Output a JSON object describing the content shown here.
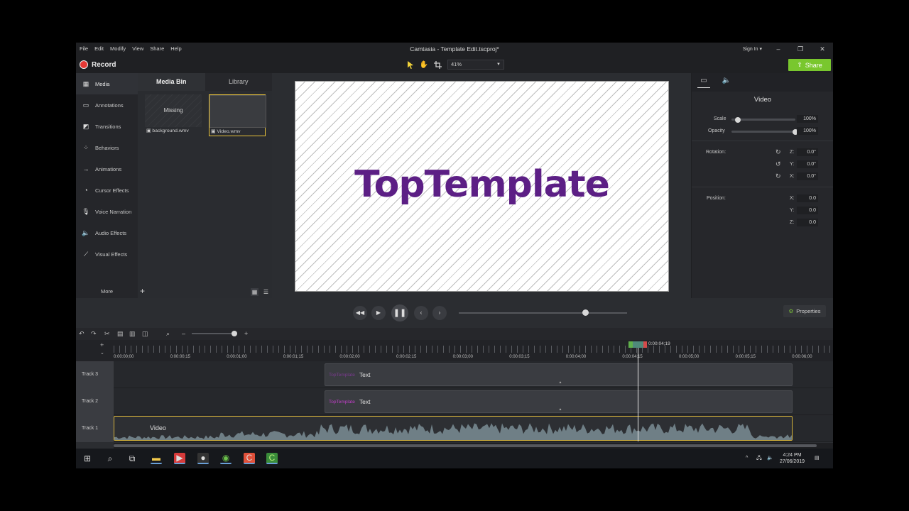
{
  "window": {
    "title": "Camtasia - Template Edit.tscproj*",
    "menu": [
      "File",
      "Edit",
      "Modify",
      "View",
      "Share",
      "Help"
    ],
    "sign_in": "Sign In ▾",
    "minimize": "–",
    "restore": "❐",
    "close": "✕"
  },
  "toolbar": {
    "record_label": "Record",
    "zoom_value": "41%",
    "share_label": "Share"
  },
  "sidebar": {
    "items": [
      {
        "label": "Media",
        "icon": "media-icon"
      },
      {
        "label": "Annotations",
        "icon": "annotations-icon"
      },
      {
        "label": "Transitions",
        "icon": "transitions-icon"
      },
      {
        "label": "Behaviors",
        "icon": "behaviors-icon"
      },
      {
        "label": "Animations",
        "icon": "animations-icon"
      },
      {
        "label": "Cursor Effects",
        "icon": "cursor-effects-icon"
      },
      {
        "label": "Voice Narration",
        "icon": "microphone-icon"
      },
      {
        "label": "Audio Effects",
        "icon": "speaker-icon"
      },
      {
        "label": "Visual Effects",
        "icon": "wand-icon"
      }
    ],
    "more_label": "More"
  },
  "media_bin": {
    "tabs": [
      "Media Bin",
      "Library"
    ],
    "items": [
      {
        "name": "background.wmv",
        "thumb_text": "Missing"
      },
      {
        "name": "Video.wmv",
        "thumb_text": ""
      }
    ]
  },
  "canvas": {
    "text": "TopTemplate"
  },
  "properties": {
    "title": "Video",
    "scale_label": "Scale",
    "scale_value": "100%",
    "scale_fraction": 0.1,
    "opacity_label": "Opacity",
    "opacity_value": "100%",
    "opacity_fraction": 1.0,
    "rotation_label": "Rotation:",
    "rotation": {
      "z": "0.0°",
      "y": "0.0°",
      "x": "0.0°"
    },
    "position_label": "Position:",
    "position": {
      "x": "0.0",
      "y": "0.0",
      "z": "0.0"
    },
    "axis_labels": {
      "z": "Z:",
      "y": "Y:",
      "x": "X:"
    }
  },
  "playback": {
    "properties_label": "Properties",
    "scrub_fraction": 0.75
  },
  "timeline": {
    "playhead_time": "0:00:04;19",
    "ruler_labels": [
      "0:00:00;00",
      "0:00:00;15",
      "0:00:01;00",
      "0:00:01;15",
      "0:00:02;00",
      "0:00:02;15",
      "0:00:03;00",
      "0:00:03;15",
      "0:00:04;00",
      "0:00:04;15",
      "0:00:05;00",
      "0:00:05;15",
      "0:00:06;00"
    ],
    "tracks": [
      {
        "name": "Track 3",
        "clip_brand": "TopTemplate",
        "clip_label": "Text"
      },
      {
        "name": "Track 2",
        "clip_brand": "TopTemplate",
        "clip_label": "Text"
      },
      {
        "name": "Track 1",
        "clip_label": "Video"
      }
    ]
  },
  "taskbar": {
    "time": "4:24 PM",
    "date": "27/06/2019"
  }
}
